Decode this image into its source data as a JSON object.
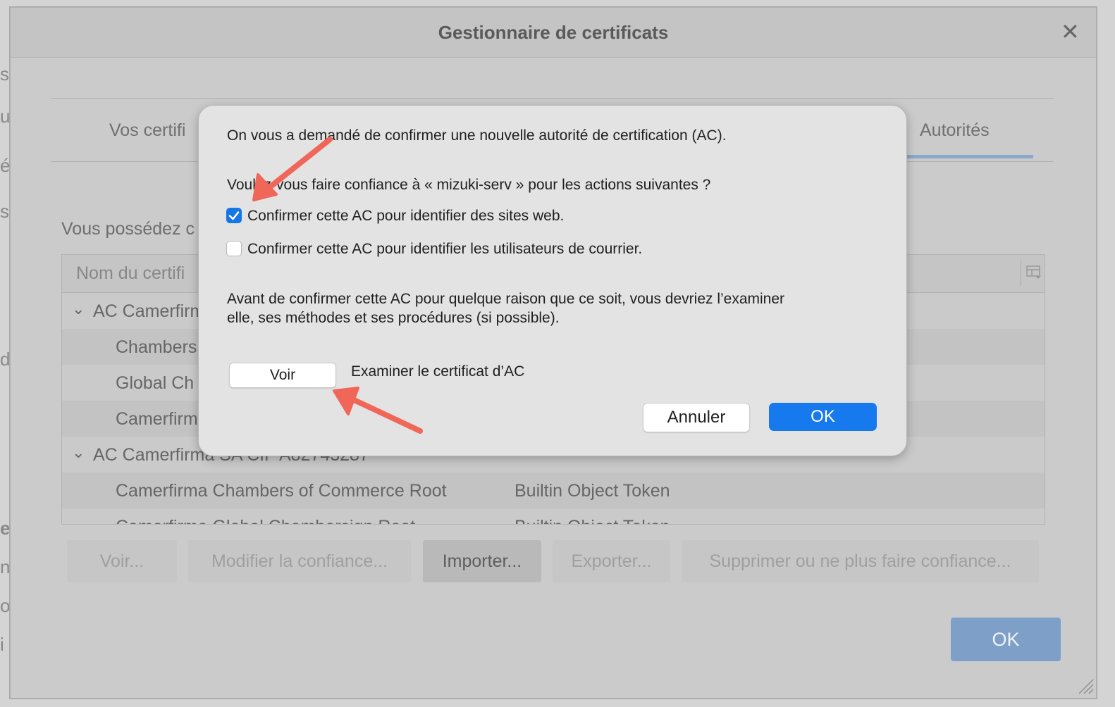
{
  "window": {
    "title": "Gestionnaire de certificats",
    "tabs": [
      "Vos certifi",
      "Autorités"
    ],
    "owns_text": "Vous possédez c",
    "table": {
      "header": "Nom du certifi",
      "rows": [
        {
          "name": "AC Camerfirm",
          "token": ""
        },
        {
          "name": "Chambers",
          "token": ""
        },
        {
          "name": "Global Ch",
          "token": ""
        },
        {
          "name": "Camerfirm",
          "token": ""
        },
        {
          "name": "AC Camerfirma SA CIF A82743287",
          "token": ""
        },
        {
          "name": "Camerfirma Chambers of Commerce Root",
          "token": "Builtin Object Token"
        },
        {
          "name": "Camerfirma Global Chambersign Root",
          "token": "Builtin Object Token"
        }
      ]
    },
    "buttons": {
      "view": "Voir...",
      "edit_trust": "Modifier la confiance...",
      "import": "Importer...",
      "export": "Exporter...",
      "delete": "Supprimer ou ne plus faire confiance..."
    },
    "ok": "OK"
  },
  "dialog": {
    "intro": "On vous a demandé de confirmer une nouvelle autorité de certification (AC).",
    "question": "Voulez-vous faire confiance à « mizuki-serv » pour les actions suivantes ?",
    "option_web": "Confirmer cette AC pour identifier des sites web.",
    "option_web_checked": true,
    "option_mail": "Confirmer cette AC pour identifier les utilisateurs de courrier.",
    "option_mail_checked": false,
    "warning_line1": "Avant de confirmer cette AC pour quelque raison que ce soit, vous devriez l’examiner",
    "warning_line2": "elle, ses méthodes et ses procédures (si possible).",
    "view_button": "Voir",
    "view_label": "Examiner le certificat d’AC",
    "cancel": "Annuler",
    "ok": "OK"
  },
  "colors": {
    "accent": "#1679ee",
    "annotation_arrow": "#f0675a"
  }
}
